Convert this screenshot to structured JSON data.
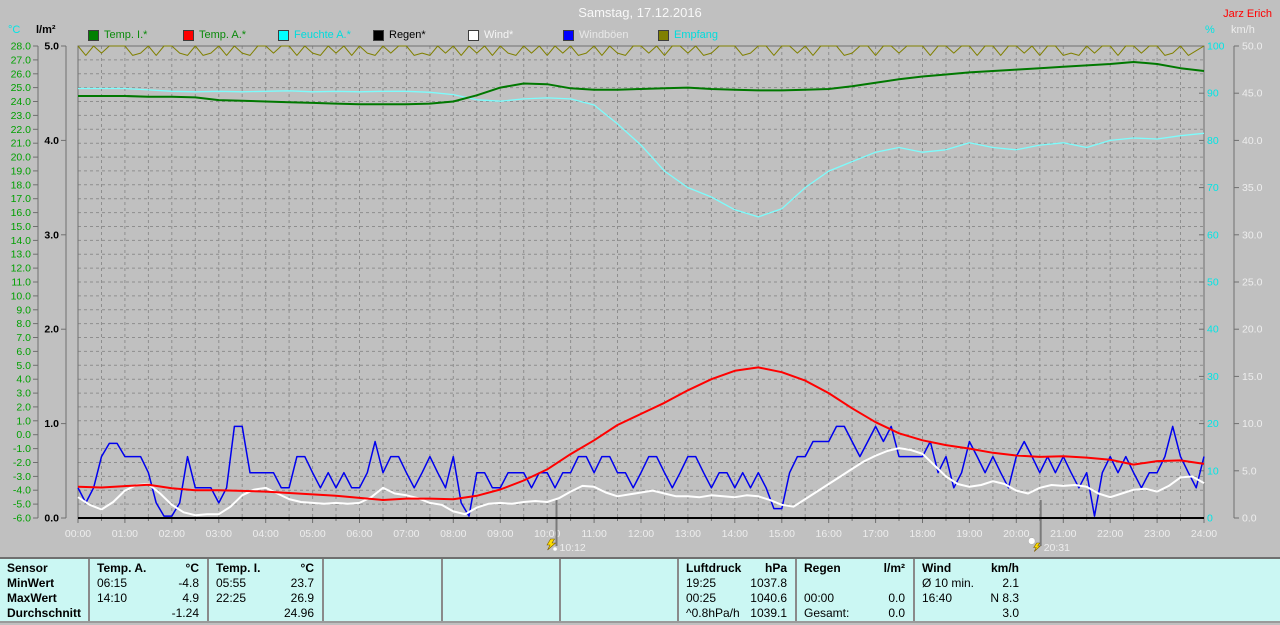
{
  "header": {
    "title": "Samstag, 17.12.2016",
    "station_label": "Jarz Erich"
  },
  "legend": {
    "items": [
      {
        "label": "Temp. I.*",
        "swatch": "#008000",
        "text_color": "#0a8a0a"
      },
      {
        "label": "Temp. A.*",
        "swatch": "#ff0000",
        "text_color": "#0a8a0a"
      },
      {
        "label": "Feuchte A.*",
        "swatch": "#00ffff",
        "text_color": "#00dcdc"
      },
      {
        "label": "Regen*",
        "swatch": "#000000",
        "text_color": "#000000"
      },
      {
        "label": "Wind*",
        "swatch": "#ffffff",
        "text_color": "#f5f5f5"
      },
      {
        "label": "Windböen",
        "swatch": "#0000ff",
        "text_color": "#e8e8e8"
      },
      {
        "label": "Empfang",
        "swatch": "#808000",
        "text_color": "#00dcdc"
      }
    ]
  },
  "chart_data": {
    "type": "line",
    "title": "Samstag, 17.12.2016",
    "xlabel": "time 00:00-24:00",
    "legend_position": "top",
    "grid": "dashed 30min vertical, 1°C horizontal",
    "x_axis": {
      "min_hour": 0,
      "max_hour": 24,
      "tick_every_hours": 1,
      "tick_label_format": "HH:00"
    },
    "axes": {
      "temp_c": {
        "title": "°C",
        "min": -6,
        "max": 28,
        "step": 1,
        "label_decimals": 1,
        "label_color": "#00a000"
      },
      "rain_lm2": {
        "title": "l/m²",
        "min": 0,
        "max": 5,
        "step": 1,
        "label_decimals": 1,
        "label_color": "#000000"
      },
      "humidity_pct": {
        "title": "%",
        "min": 0,
        "max": 100,
        "step": 10,
        "label_decimals": 0,
        "label_color": "#00e5e5"
      },
      "wind_kmh": {
        "title": "km/h",
        "min": 0,
        "max": 50,
        "step": 5,
        "label_decimals": 1,
        "label_color": "#ededed"
      }
    },
    "markers": [
      {
        "label": "10:12",
        "hour": 10.2,
        "icon": "lightning"
      },
      {
        "label": "20:31",
        "hour": 20.52,
        "icon": "cloud-lightning"
      }
    ],
    "series": [
      {
        "id": "regen",
        "name": "Regen",
        "axis": "rain_lm2",
        "color": "#000000",
        "width": 1.2,
        "interval_min": 60,
        "values": [
          0,
          0,
          0,
          0,
          0,
          0,
          0,
          0,
          0,
          0,
          0,
          0,
          0,
          0,
          0,
          0,
          0,
          0,
          0,
          0,
          0,
          0,
          0,
          0,
          0
        ]
      },
      {
        "id": "empfang",
        "name": "Empfang",
        "axis": "humidity_pct",
        "color": "#808000",
        "width": 1,
        "interval_min": 10,
        "values": [
          100,
          98,
          100,
          98.5,
          100,
          100,
          100,
          98,
          98.5,
          100,
          98,
          100,
          100,
          98.5,
          98,
          100,
          98,
          98.5,
          100,
          98,
          100,
          98.5,
          98,
          100,
          100,
          98.5,
          100,
          100,
          98,
          100,
          98.5,
          98,
          100,
          98.5,
          100,
          98,
          100,
          98.5,
          98,
          100,
          98.5,
          100,
          100,
          98,
          98.5,
          98,
          100,
          98.5,
          100,
          98,
          100,
          98.5,
          100,
          98,
          100,
          98.5,
          98,
          100,
          98.5,
          100,
          98,
          100,
          98.5,
          100,
          98,
          98.5,
          100,
          98,
          100,
          98.5,
          98,
          100,
          100,
          98.5,
          100,
          98,
          100,
          100,
          98.5,
          100,
          98,
          98.5,
          100,
          100,
          100,
          98,
          98.5,
          100,
          100,
          98,
          100,
          100,
          98.5,
          100,
          98,
          100,
          100,
          100,
          98,
          98.5,
          100,
          100,
          98,
          100,
          100,
          98.5,
          100,
          100,
          100,
          98,
          100,
          100,
          98.5,
          100,
          100,
          98,
          100,
          100,
          98,
          100,
          100,
          98.5,
          100,
          98,
          100,
          100,
          98,
          98.5,
          98,
          100,
          98.5,
          100,
          100,
          98,
          100,
          100,
          98.5,
          100,
          100,
          98,
          98.5,
          100,
          98,
          99,
          100
        ]
      },
      {
        "id": "feuchte_a",
        "name": "Feuchte A.",
        "axis": "humidity_pct",
        "color": "#7dfcfc",
        "width": 1.3,
        "interval_min": 30,
        "values": [
          91,
          91,
          91,
          90.7,
          90.4,
          90.3,
          90.4,
          90.3,
          90.4,
          90.5,
          90.3,
          90.4,
          90.3,
          90.4,
          90.4,
          90.2,
          89.7,
          88.6,
          88.3,
          88.8,
          89.0,
          88.8,
          87.5,
          83.5,
          79.0,
          73.5,
          70.0,
          68.0,
          65.3,
          63.8,
          65.5,
          70.0,
          73.5,
          75.5,
          77.5,
          78.5,
          77.5,
          78.0,
          79.5,
          78.5,
          78.0,
          79.0,
          79.5,
          78.5,
          80.0,
          80.5,
          80.3,
          81.0,
          81.5
        ]
      },
      {
        "id": "temp_i",
        "name": "Temp. I.",
        "axis": "temp_c",
        "color": "#007800",
        "width": 2,
        "interval_min": 30,
        "values": [
          24.4,
          24.4,
          24.4,
          24.35,
          24.35,
          24.3,
          24.1,
          24.05,
          24.0,
          23.95,
          23.9,
          23.85,
          23.8,
          23.8,
          23.8,
          23.85,
          24.0,
          24.45,
          25.0,
          25.3,
          25.25,
          24.95,
          24.85,
          24.85,
          24.9,
          24.95,
          25.0,
          24.9,
          24.85,
          24.8,
          24.8,
          24.85,
          24.9,
          25.1,
          25.35,
          25.6,
          25.8,
          25.95,
          26.1,
          26.2,
          26.3,
          26.4,
          26.5,
          26.6,
          26.7,
          26.85,
          26.7,
          26.4,
          26.2
        ]
      },
      {
        "id": "windboeen",
        "name": "Windböen",
        "axis": "wind_kmh",
        "color": "#0000ee",
        "width": 1.5,
        "interval_min": 10,
        "values": [
          3.2,
          1.6,
          3.2,
          6.5,
          7.9,
          7.9,
          6.5,
          6.5,
          6.5,
          4.8,
          1.6,
          0.2,
          0.2,
          1.6,
          6.5,
          3.2,
          3.2,
          3.2,
          1.6,
          3.2,
          9.7,
          9.7,
          4.8,
          4.8,
          4.8,
          4.8,
          3.2,
          3.2,
          6.5,
          6.5,
          4.8,
          3.2,
          4.8,
          3.2,
          4.8,
          3.2,
          3.2,
          4.8,
          8.1,
          4.8,
          6.5,
          6.5,
          4.8,
          3.2,
          4.8,
          6.5,
          4.8,
          3.2,
          6.5,
          1.6,
          0.2,
          4.8,
          4.8,
          3.2,
          3.2,
          4.8,
          4.8,
          4.8,
          3.2,
          4.8,
          4.8,
          3.2,
          4.8,
          4.8,
          6.5,
          6.5,
          4.8,
          6.5,
          6.5,
          4.8,
          4.8,
          3.2,
          4.8,
          6.5,
          6.5,
          4.8,
          3.2,
          4.8,
          6.5,
          6.5,
          4.8,
          3.2,
          4.8,
          4.8,
          3.2,
          4.8,
          3.2,
          4.8,
          3.2,
          1.0,
          1.0,
          4.8,
          6.5,
          6.5,
          8.1,
          8.1,
          8.1,
          9.7,
          9.7,
          8.1,
          6.5,
          8.1,
          9.7,
          8.1,
          9.7,
          6.5,
          6.5,
          6.5,
          6.5,
          8.1,
          4.8,
          6.5,
          3.2,
          4.8,
          8.1,
          6.5,
          4.8,
          6.5,
          4.8,
          3.2,
          6.5,
          8.1,
          6.5,
          4.8,
          6.5,
          4.8,
          6.5,
          4.8,
          3.2,
          4.8,
          0.2,
          4.8,
          6.5,
          4.8,
          6.5,
          4.8,
          3.2,
          4.8,
          4.8,
          6.5,
          9.7,
          6.5,
          4.8,
          3.2,
          6.5
        ]
      },
      {
        "id": "wind",
        "name": "Wind",
        "axis": "wind_kmh",
        "color": "#ffffff",
        "width": 2,
        "interval_min": 15,
        "values": [
          2.2,
          1.4,
          0.9,
          1.7,
          2.9,
          3.5,
          3.6,
          2.6,
          1.4,
          0.6,
          0.3,
          0.4,
          0.4,
          1.2,
          2.4,
          3.0,
          3.2,
          2.6,
          2.0,
          1.7,
          1.6,
          1.5,
          1.6,
          1.5,
          1.6,
          2.2,
          3.2,
          2.6,
          2.4,
          2.1,
          1.6,
          1.4,
          0.7,
          0.4,
          1.1,
          1.5,
          1.6,
          1.5,
          1.7,
          1.8,
          1.7,
          2.1,
          2.8,
          3.4,
          3.3,
          2.7,
          2.3,
          2.5,
          2.7,
          2.9,
          2.6,
          2.3,
          2.3,
          2.2,
          2.4,
          2.3,
          2.2,
          2.4,
          2.3,
          1.9,
          1.4,
          1.2,
          2.0,
          2.8,
          3.6,
          4.4,
          5.2,
          6.0,
          6.6,
          7.1,
          7.4,
          7.2,
          6.8,
          5.6,
          4.4,
          3.6,
          3.3,
          3.5,
          3.9,
          3.6,
          2.9,
          2.6,
          3.2,
          3.5,
          3.4,
          3.5,
          3.3,
          2.6,
          2.2,
          2.6,
          3.0,
          3.1,
          2.8,
          3.4,
          4.3,
          4.4,
          3.7
        ]
      },
      {
        "id": "temp_a",
        "name": "Temp. A.",
        "axis": "temp_c",
        "color": "#ff0000",
        "width": 2,
        "interval_min": 30,
        "values": [
          -3.75,
          -3.8,
          -3.7,
          -3.6,
          -3.85,
          -4.0,
          -4.0,
          -4.05,
          -4.1,
          -4.2,
          -4.3,
          -4.4,
          -4.55,
          -4.7,
          -4.6,
          -4.6,
          -4.65,
          -4.4,
          -3.95,
          -3.3,
          -2.5,
          -1.4,
          -0.4,
          0.7,
          1.5,
          2.3,
          3.2,
          4.0,
          4.6,
          4.85,
          4.5,
          3.9,
          3.0,
          1.9,
          0.9,
          0.1,
          -0.4,
          -0.75,
          -1.0,
          -1.3,
          -1.5,
          -1.6,
          -1.55,
          -1.65,
          -1.8,
          -2.15,
          -1.9,
          -1.85,
          -2.1
        ]
      }
    ]
  },
  "stats": {
    "row_labels": [
      "Sensor",
      "MinWert",
      "MaxWert",
      "Durchschnitt"
    ],
    "temp_a": {
      "name": "Temp. A.",
      "unit": "°C",
      "min_time": "06:15",
      "min": "-4.8",
      "max_time": "14:10",
      "max": "4.9",
      "avg": "-1.24"
    },
    "temp_i": {
      "name": "Temp. I.",
      "unit": "°C",
      "min_time": "05:55",
      "min": "23.7",
      "max_time": "22:25",
      "max": "26.9",
      "avg": "24.96"
    },
    "pressure": {
      "name": "Luftdruck",
      "unit": "hPa",
      "r1_l": "19:25",
      "r1_v": "1037.8",
      "r2_l": "00:25",
      "r2_v": "1040.6",
      "r3_l": "^0.8hPa/h",
      "r3_v": "1039.1"
    },
    "rain": {
      "name": "Regen",
      "unit": "l/m²",
      "r1_l": "",
      "r1_v": "",
      "r2_l": "00:00",
      "r2_v": "0.0",
      "r3_l": "Gesamt:",
      "r3_v": "0.0"
    },
    "wind": {
      "name": "Wind",
      "unit": "km/h",
      "r1_l": "Ø 10 min.",
      "r1_v": "2.1",
      "r2_l": "16:40",
      "r2_v": "N 8.3",
      "r3_l": "",
      "r3_v": "3.0"
    }
  }
}
